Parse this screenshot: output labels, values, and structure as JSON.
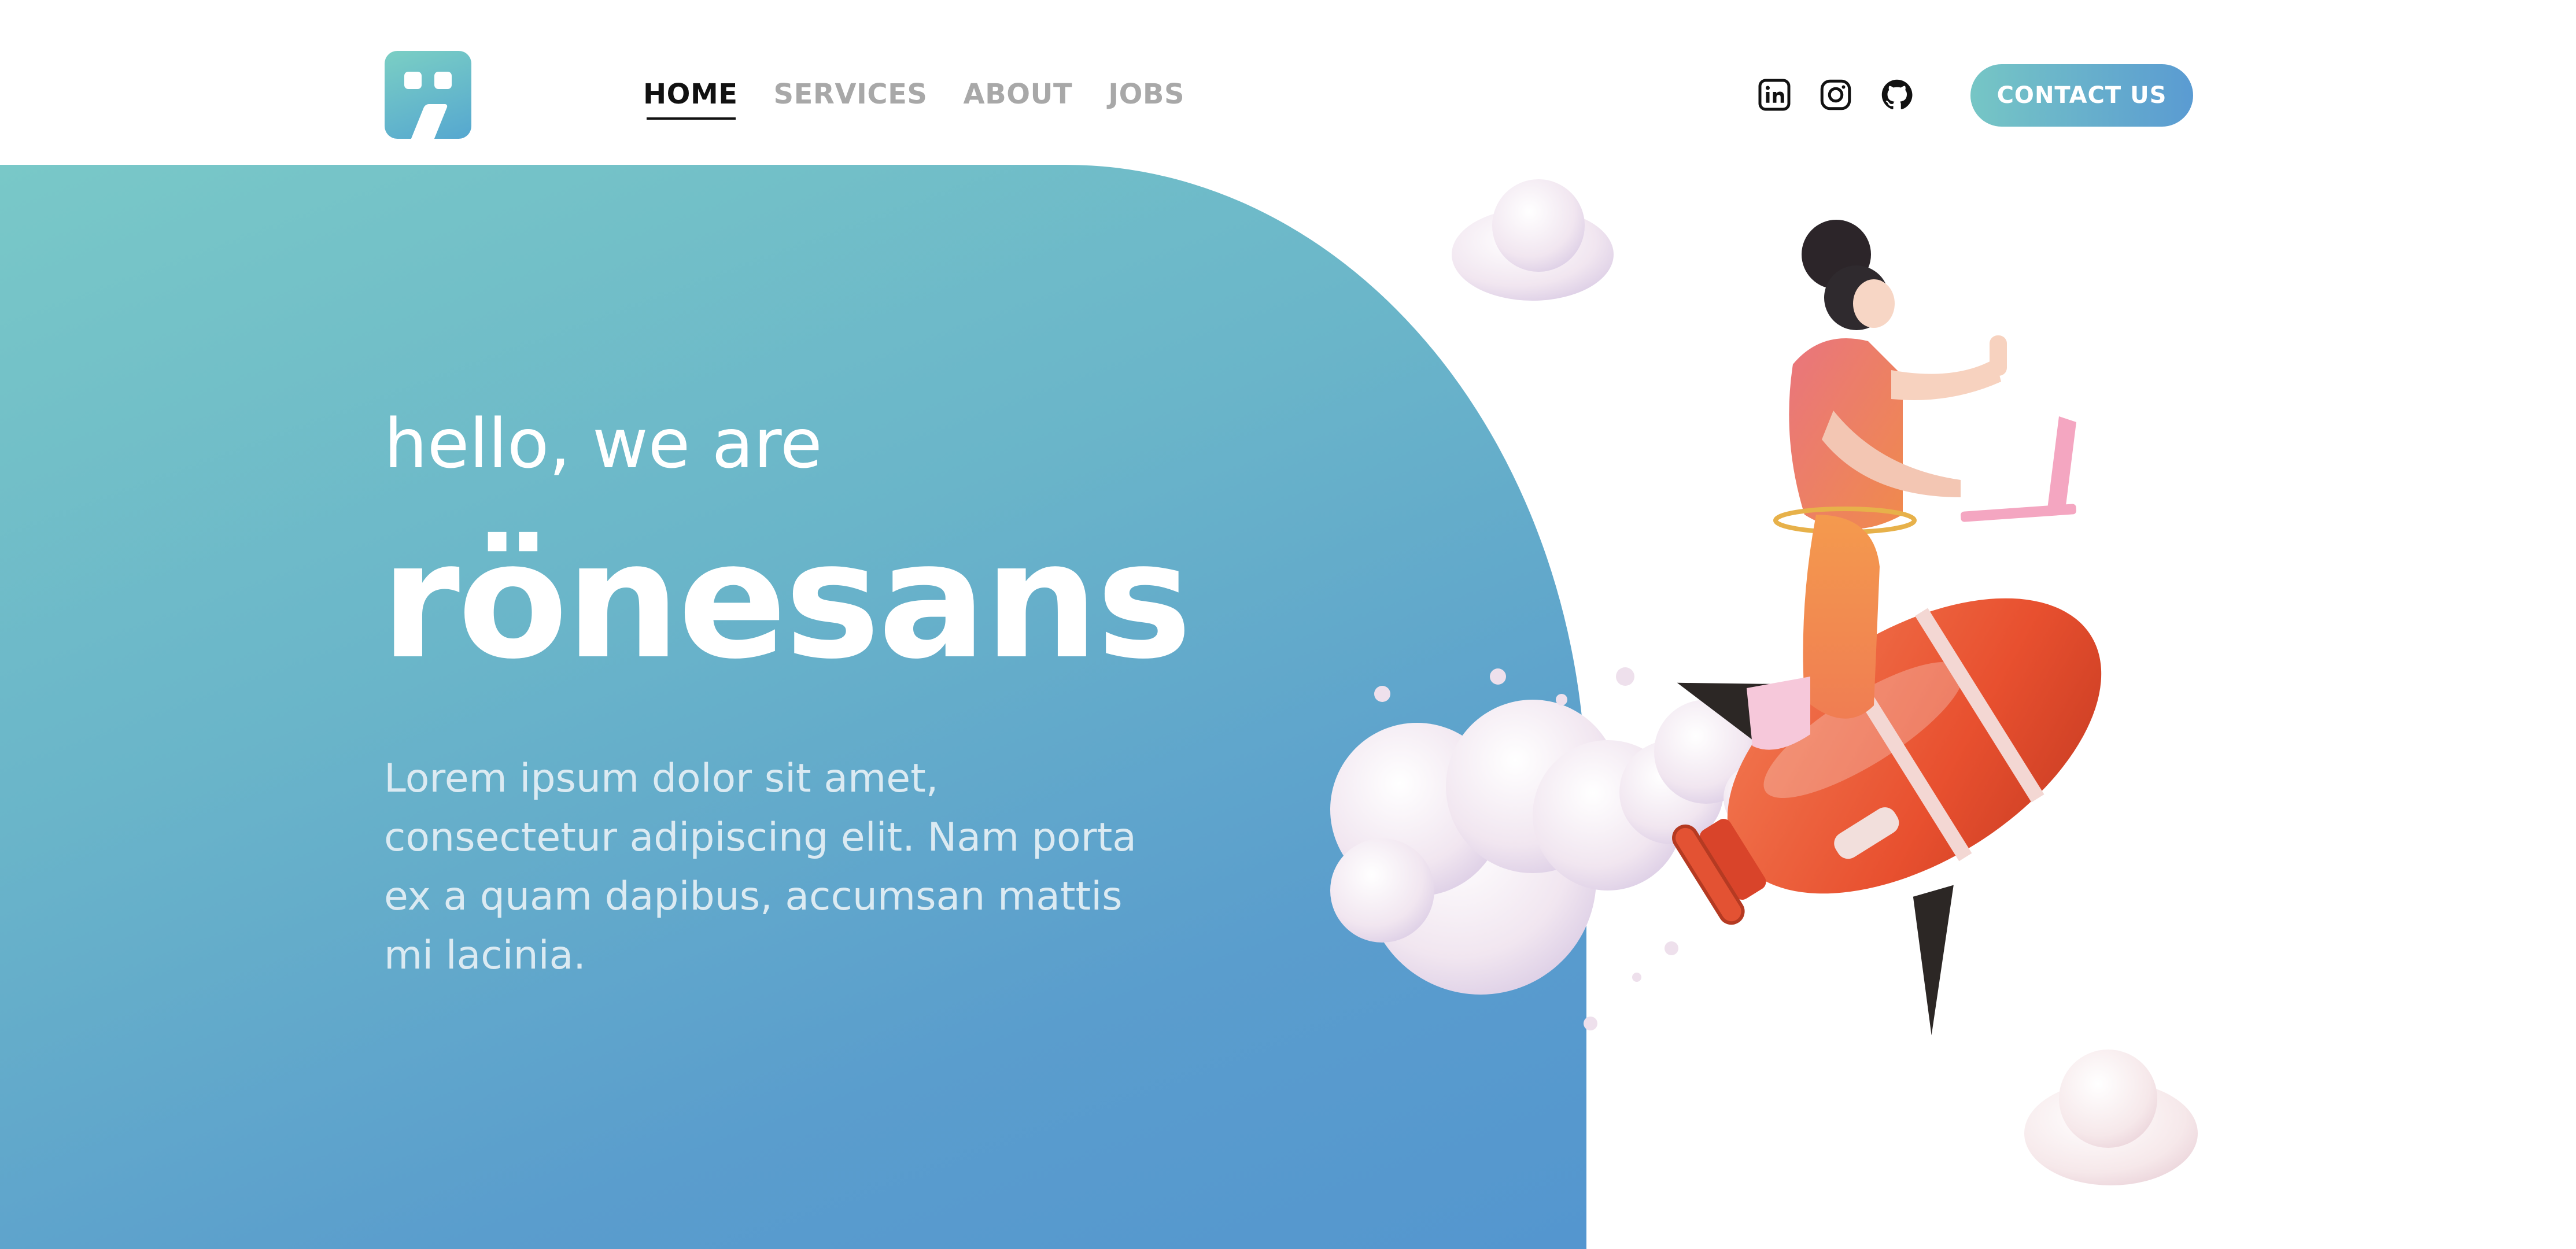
{
  "header": {
    "logo_name": "ronesans-logo",
    "nav": [
      {
        "label": "HOME",
        "active": true
      },
      {
        "label": "SERVICES",
        "active": false
      },
      {
        "label": "ABOUT",
        "active": false
      },
      {
        "label": "JOBS",
        "active": false
      }
    ],
    "social_icons": [
      "linkedin-icon",
      "instagram-icon",
      "github-icon"
    ],
    "contact_label": "CONTACT US"
  },
  "hero": {
    "greeting": "hello, we are",
    "title": "rönesans",
    "description": "Lorem ipsum dolor sit amet, consectetur adipiscing elit. Nam porta ex a quam dapibus, accumsan mattis mi lacinia."
  },
  "colors": {
    "gradient_start": "#79c8c8",
    "gradient_end": "#5496cf",
    "nav_active": "#111111",
    "nav_inactive": "#a8a8a8",
    "rocket": "#e85a3c"
  }
}
